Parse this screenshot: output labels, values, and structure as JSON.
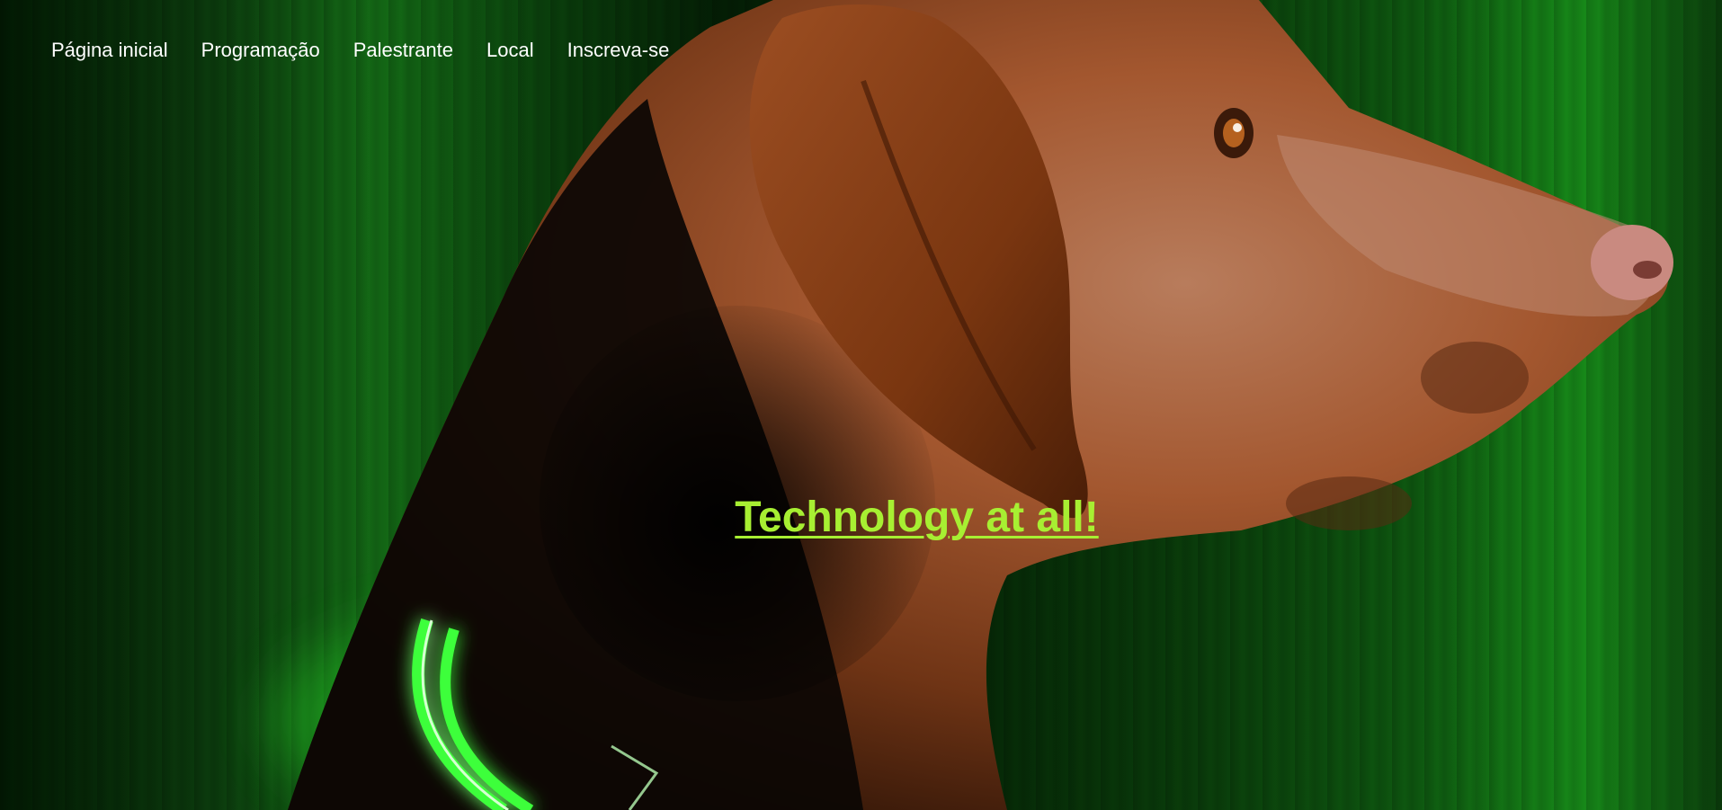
{
  "nav": {
    "items": [
      {
        "label": "Página inicial"
      },
      {
        "label": "Programação"
      },
      {
        "label": "Palestrante"
      },
      {
        "label": "Local"
      },
      {
        "label": "Inscreva-se"
      }
    ]
  },
  "hero": {
    "headline": "Technology at all!",
    "background_image": "dog-with-glowing-collar",
    "accent_color": "#a7ef32",
    "background_color": "#0b3e0c"
  }
}
